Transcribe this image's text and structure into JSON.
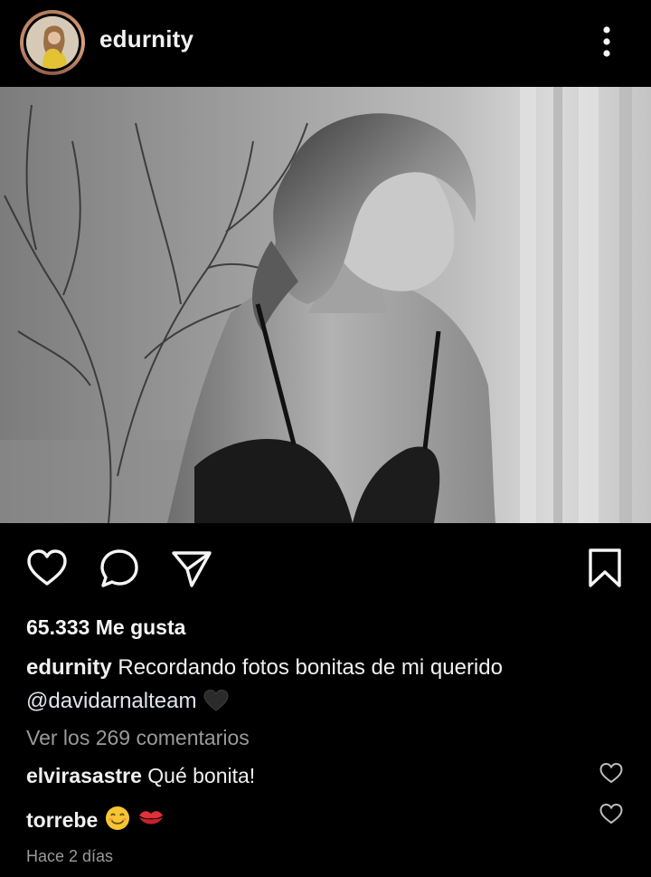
{
  "post": {
    "username": "edurnity",
    "photo_description": "",
    "likes_text": "65.333 Me gusta",
    "caption": {
      "user": "edurnity",
      "text": "Recordando fotos bonitas de mi querido",
      "mention": "@davidarnalteam",
      "emoji": "black-heart"
    },
    "view_comments": "Ver los 269 comentarios",
    "comments": [
      {
        "user": "elvirasastre",
        "text": "Qué bonita!"
      },
      {
        "user": "torrebe",
        "text": ""
      }
    ],
    "timestamp": "Hace 2 días"
  },
  "icons": {
    "like": "heart-outline-icon",
    "comment": "comment-bubble-icon",
    "share": "paper-plane-icon",
    "save": "bookmark-outline-icon",
    "more": "vertical-dots-icon"
  },
  "colors": {
    "background": "#000000",
    "text": "#f5f5f5",
    "muted": "#9a9a9a"
  }
}
